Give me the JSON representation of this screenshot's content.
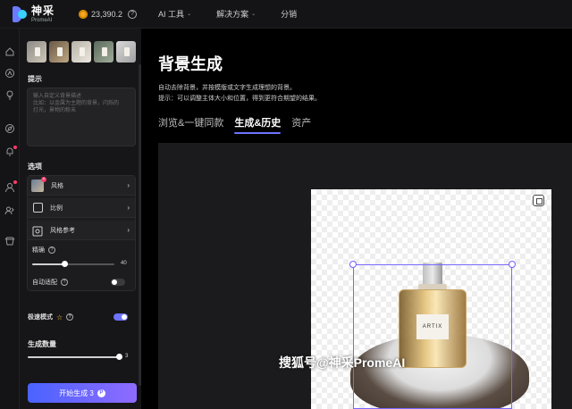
{
  "app": {
    "logo_cn": "神采",
    "logo_en": "PromeAI",
    "credits": "23,390.2",
    "help_symbol": "?"
  },
  "nav": {
    "items": [
      {
        "label": "AI 工具",
        "has_dropdown": true
      },
      {
        "label": "解决方案",
        "has_dropdown": true
      },
      {
        "label": "分销",
        "has_dropdown": false
      }
    ],
    "chevron": "⌄"
  },
  "rail": {
    "icons": [
      "home-icon",
      "ai-badge-icon",
      "bulb-icon",
      "compass-icon",
      "bell-icon",
      "user-icon",
      "team-icon",
      "shop-icon"
    ]
  },
  "panel": {
    "prompt_label": "提示",
    "prompt_placeholder_1": "输入自定义背景描述",
    "prompt_placeholder_2": "比如：以金属为主题的背景，闪烁的",
    "prompt_placeholder_3": "灯光，景物的粉末",
    "options_label": "选项",
    "style_label": "风格",
    "ratio_label": "比例",
    "ref_label": "风格参考",
    "precision_label": "精确",
    "precision_value": "40",
    "precision_fraction": 0.4,
    "auto_fit_label": "自动适配",
    "auto_fit_on": false,
    "fast_mode_label": "极速模式",
    "fast_mode_on": true,
    "count_label": "生成数量",
    "count_value": "3",
    "generate_label": "开始生成 3",
    "generate_cost_symbol": "P",
    "chevron": "›",
    "remove_symbol": "×"
  },
  "main": {
    "title": "背景生成",
    "desc_1": "自动去除背景，并按模版或文字生成理想的背景。",
    "desc_2": "提示：可以调整主体大小和位置，得到更符合期望的结果。",
    "tabs": [
      {
        "label": "浏览&一键同款",
        "active": false
      },
      {
        "label": "生成&历史",
        "active": true
      },
      {
        "label": "资产",
        "active": false
      }
    ],
    "product_label": "ARTIX"
  },
  "watermark": "搜狐号@神采PromeAI",
  "colors": {
    "accent": "#6e73ff",
    "gradient_start": "#4a63ff",
    "gradient_end": "#8f6bff",
    "badge": "#ff3b6b"
  }
}
